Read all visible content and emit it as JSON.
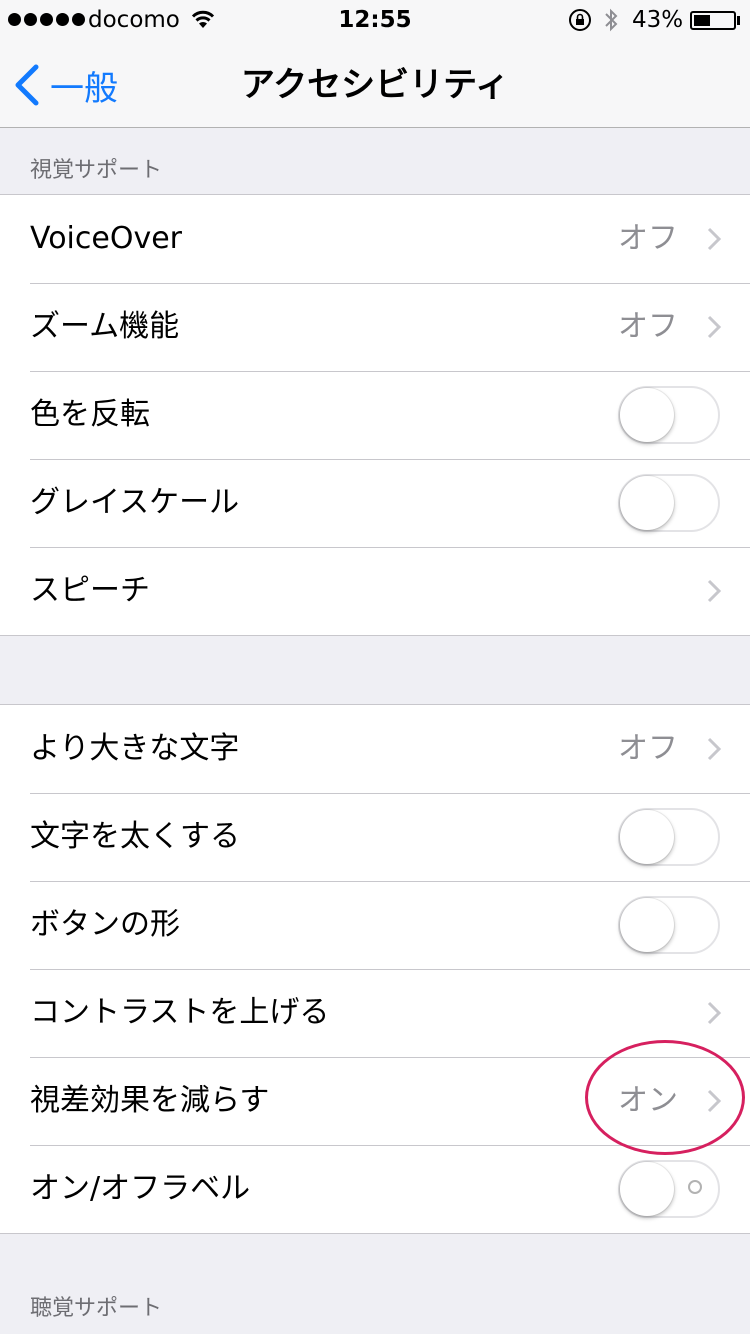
{
  "status_bar": {
    "carrier": "docomo",
    "time": "12:55",
    "battery_percent": "43%",
    "battery_level": 0.43
  },
  "nav": {
    "back_label": "一般",
    "title": "アクセシビリティ",
    "accent_color": "#127afe"
  },
  "sections": {
    "vision_header": "視覚サポート",
    "hearing_header": "聴覚サポート"
  },
  "group1": [
    {
      "label": "VoiceOver",
      "value": "オフ",
      "kind": "disclosure"
    },
    {
      "label": "ズーム機能",
      "value": "オフ",
      "kind": "disclosure"
    },
    {
      "label": "色を反転",
      "kind": "toggle",
      "on": false
    },
    {
      "label": "グレイスケール",
      "kind": "toggle",
      "on": false
    },
    {
      "label": "スピーチ",
      "kind": "disclosure"
    }
  ],
  "group2": [
    {
      "label": "より大きな文字",
      "value": "オフ",
      "kind": "disclosure"
    },
    {
      "label": "文字を太くする",
      "kind": "toggle",
      "on": false
    },
    {
      "label": "ボタンの形",
      "kind": "toggle",
      "on": false
    },
    {
      "label": "コントラストを上げる",
      "kind": "disclosure"
    },
    {
      "label": "視差効果を減らす",
      "value": "オン",
      "kind": "disclosure"
    },
    {
      "label": "オン/オフラベル",
      "kind": "toggle",
      "on": false
    }
  ],
  "annotation_color": "#d6205f"
}
